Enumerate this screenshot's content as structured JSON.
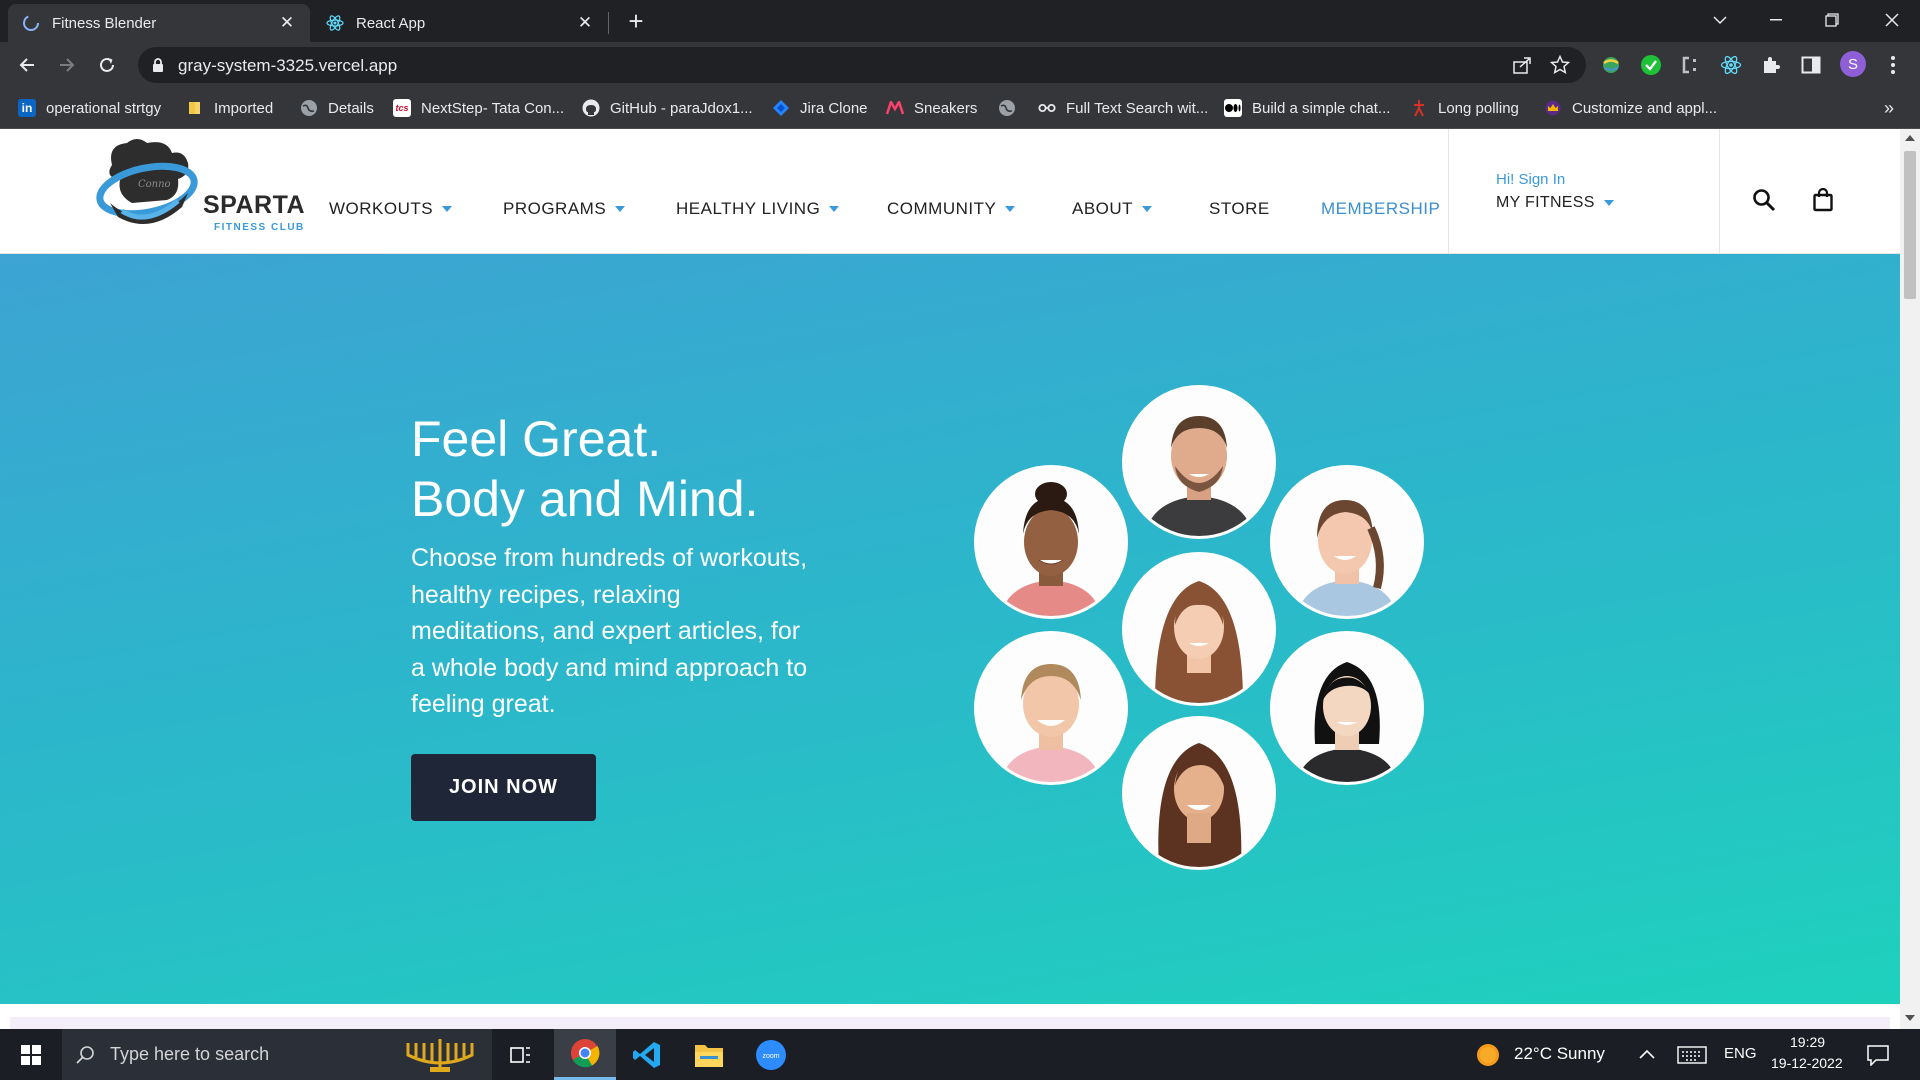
{
  "browser": {
    "tabs": [
      {
        "title": "Fitness Blender",
        "active": true
      },
      {
        "title": "React App",
        "active": false
      }
    ],
    "url": "gray-system-3325.vercel.app",
    "profile_initial": "S",
    "bookmarks": [
      {
        "label": "operational strtgy",
        "icon": "linkedin-icon"
      },
      {
        "label": "Imported",
        "icon": "folder-icon"
      },
      {
        "label": "Details",
        "icon": "globe-icon"
      },
      {
        "label": "NextStep- Tata Con...",
        "icon": "tcs-icon"
      },
      {
        "label": "GitHub - paraJdox1...",
        "icon": "github-icon"
      },
      {
        "label": "Jira Clone",
        "icon": "jira-icon"
      },
      {
        "label": "Sneakers",
        "icon": "myntra-icon"
      },
      {
        "label": "Full Text Search wit...",
        "icon": "link-icon"
      },
      {
        "label": "Build a simple chat...",
        "icon": "medium-icon"
      },
      {
        "label": "Long polling",
        "icon": "long-polling-icon"
      },
      {
        "label": "Customize and appl...",
        "icon": "crown-icon"
      }
    ],
    "more_bookmarks": "»"
  },
  "site": {
    "brand": "SPARTA",
    "brand_sub": "FITNESS CLUB",
    "logo_text": "Conno",
    "nav": [
      {
        "label": "WORKOUTS",
        "caret": true
      },
      {
        "label": "PROGRAMS",
        "caret": true
      },
      {
        "label": "HEALTHY LIVING",
        "caret": true
      },
      {
        "label": "COMMUNITY",
        "caret": true
      },
      {
        "label": "ABOUT",
        "caret": true
      },
      {
        "label": "STORE",
        "caret": false
      },
      {
        "label": "MEMBERSHIP",
        "caret": false
      }
    ],
    "signin": "Hi! Sign In",
    "myfitness": "MY FITNESS"
  },
  "hero": {
    "heading_line1": "Feel Great.",
    "heading_line2": "Body and Mind.",
    "description": "Choose from hundreds of workouts, healthy recipes, relaxing meditations, and expert articles, for a whole body and mind approach to feeling great.",
    "cta": "JOIN NOW"
  },
  "taskbar": {
    "search_placeholder": "Type here to search",
    "weather": "22°C  Sunny",
    "language": "ENG",
    "time": "19:29",
    "date": "19-12-2022"
  },
  "colors": {
    "hero_top": "#3da3d3",
    "hero_bottom": "#1fd1bd",
    "accent": "#3a9ad9",
    "button": "#1e2638"
  }
}
